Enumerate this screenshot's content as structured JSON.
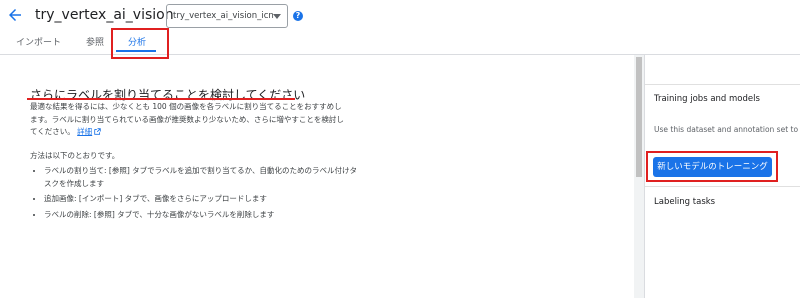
{
  "header": {
    "title": "try_vertex_ai_vision",
    "dataset_select_value": "try_vertex_ai_vision_icn",
    "help_glyph": "?"
  },
  "tabs": [
    {
      "label": "インポート"
    },
    {
      "label": "参照"
    },
    {
      "label": "分析"
    }
  ],
  "main": {
    "heading": "さらにラベルを割り当てることを検討してください",
    "paragraph": "最適な結果を得るには、少なくとも 100 個の画像を各ラベルに割り当てることをおすすめします。ラベルに割り当てられている画像が推奨数より少ないため、さらに増やすことを検討してください。",
    "detail_link": "詳細",
    "list_intro": "方法は以下のとおりです。",
    "list_items": [
      "ラベルの割り当て: [参照] タブでラベルを追加で割り当てるか、自動化のためのラベル付けタスクを作成します",
      "追加画像: [インポート] タブで、画像をさらにアップロードします",
      "ラベルの削除: [参照] タブで、十分な画像がないラベルを削除します"
    ]
  },
  "right_panel": {
    "training_title": "Training jobs and models",
    "training_desc": "Use this dataset and annotation set to tra",
    "train_button": "新しいモデルのトレーニング",
    "labeling_title": "Labeling tasks"
  },
  "colors": {
    "accent": "#1a73e8",
    "highlight": "#e02020"
  }
}
